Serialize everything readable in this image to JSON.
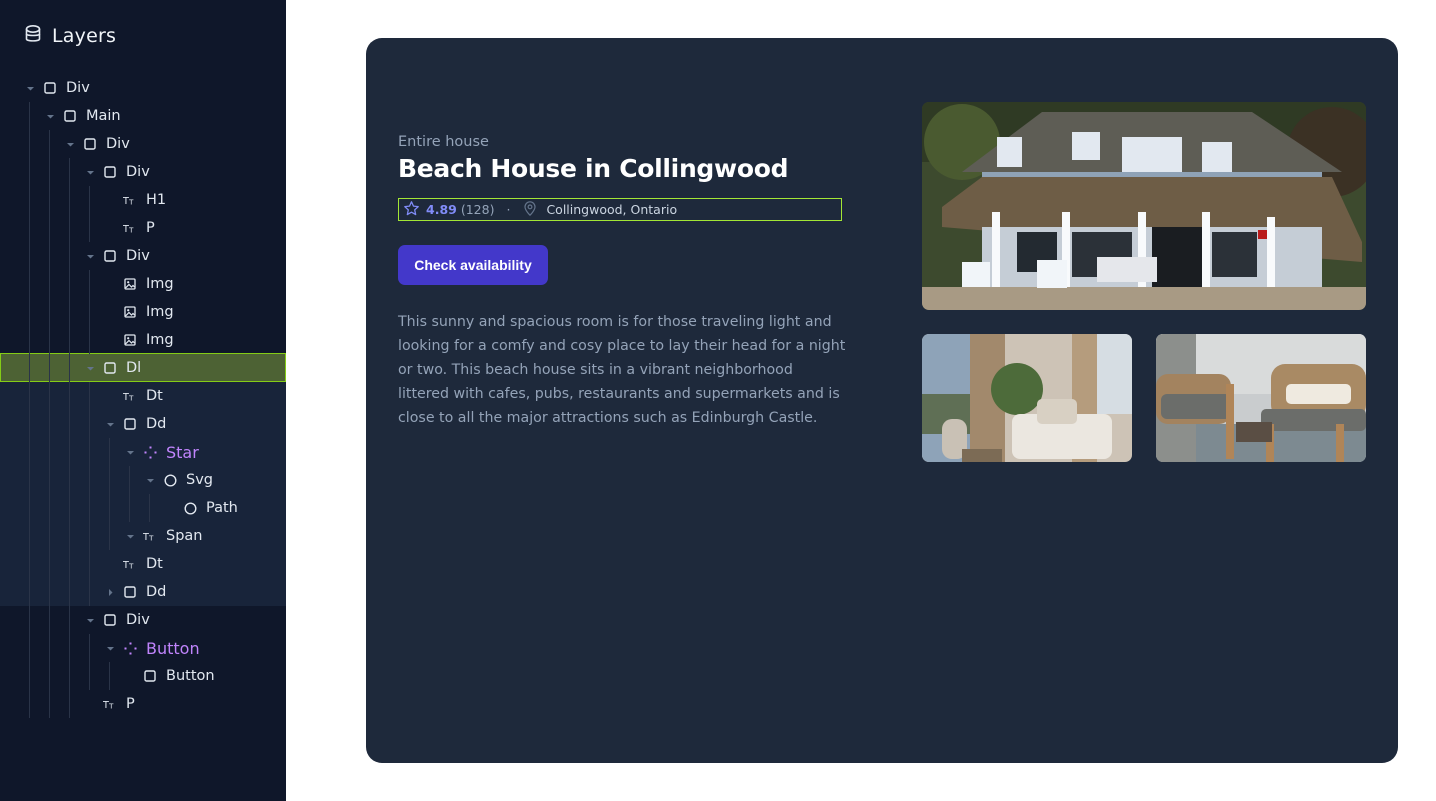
{
  "sidebar": {
    "title": "Layers",
    "tree": [
      {
        "label": "Div",
        "icon": "box",
        "depth": 0,
        "caret": "down"
      },
      {
        "label": "Main",
        "icon": "box",
        "depth": 1,
        "caret": "down"
      },
      {
        "label": "Div",
        "icon": "box",
        "depth": 2,
        "caret": "down"
      },
      {
        "label": "Div",
        "icon": "box",
        "depth": 3,
        "caret": "down"
      },
      {
        "label": "H1",
        "icon": "text",
        "depth": 4,
        "caret": ""
      },
      {
        "label": "P",
        "icon": "text",
        "depth": 4,
        "caret": ""
      },
      {
        "label": "Div",
        "icon": "box",
        "depth": 3,
        "caret": "down"
      },
      {
        "label": "Img",
        "icon": "image",
        "depth": 4,
        "caret": ""
      },
      {
        "label": "Img",
        "icon": "image",
        "depth": 4,
        "caret": ""
      },
      {
        "label": "Img",
        "icon": "image",
        "depth": 4,
        "caret": ""
      },
      {
        "label": "Dl",
        "icon": "box",
        "depth": 3,
        "caret": "down",
        "selected": true
      },
      {
        "label": "Dt",
        "icon": "text",
        "depth": 4,
        "caret": ""
      },
      {
        "label": "Dd",
        "icon": "box",
        "depth": 4,
        "caret": "down"
      },
      {
        "label": "Star",
        "icon": "component",
        "depth": 5,
        "caret": "down",
        "component": true
      },
      {
        "label": "Svg",
        "icon": "circle",
        "depth": 6,
        "caret": "down"
      },
      {
        "label": "Path",
        "icon": "circle",
        "depth": 7,
        "caret": ""
      },
      {
        "label": "Span",
        "icon": "text",
        "depth": 5,
        "caret": "down"
      },
      {
        "label": "Dt",
        "icon": "text",
        "depth": 4,
        "caret": ""
      },
      {
        "label": "Dd",
        "icon": "box",
        "depth": 4,
        "caret": "right"
      },
      {
        "label": "Div",
        "icon": "box",
        "depth": 3,
        "caret": "down"
      },
      {
        "label": "Button",
        "icon": "component",
        "depth": 4,
        "caret": "down",
        "component": true
      },
      {
        "label": "Button",
        "icon": "box",
        "depth": 5,
        "caret": ""
      },
      {
        "label": "P",
        "icon": "text",
        "depth": 3,
        "caret": ""
      }
    ]
  },
  "listing": {
    "eyebrow": "Entire house",
    "title": "Beach House in Collingwood",
    "rating": "4.89",
    "review_count": "(128)",
    "separator": "·",
    "location": "Collingwood, Ontario",
    "cta_label": "Check availability",
    "description": "This sunny and spacious room is for those traveling light and looking for a comfy and cosy place to lay their head for a night or two. This beach house sits in a vibrant neighborhood littered with cafes, pubs, restaurants and supermarkets and is close to all the major attractions such as Edinburgh Castle."
  },
  "colors": {
    "sidebar_bg": "#0f172a",
    "selection": "#4d6234",
    "selection_border": "#84cc16",
    "card_bg": "#1e293b",
    "accent": "#4338ca",
    "rating": "#818cf8",
    "component_label": "#c084fc"
  }
}
